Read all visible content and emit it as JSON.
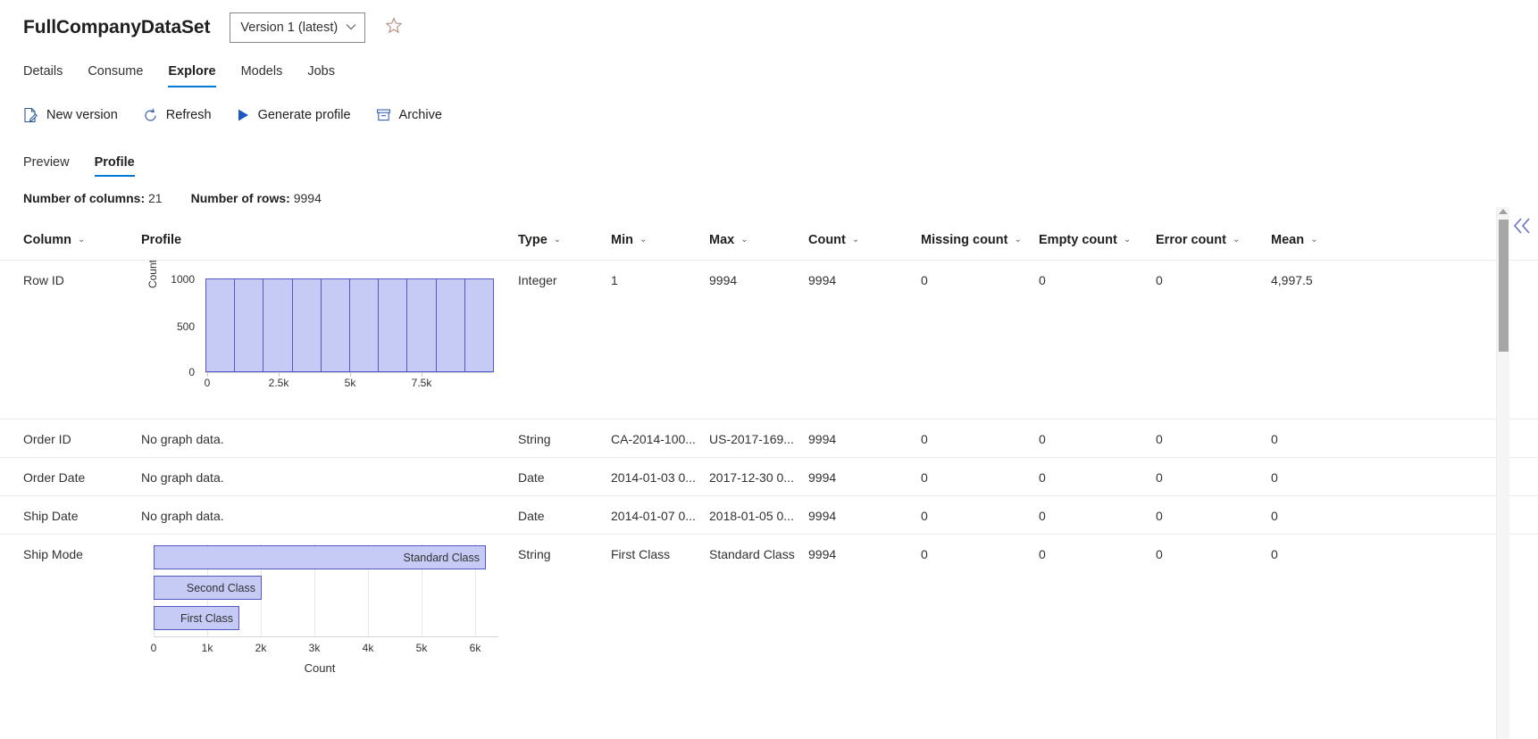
{
  "header": {
    "dataset_title": "FullCompanyDataSet",
    "version_value": "Version 1 (latest)",
    "version_chevron": "chevron-down-icon",
    "favorite_icon": "star-outline-icon"
  },
  "pivot_tabs": [
    {
      "label": "Details",
      "selected": false
    },
    {
      "label": "Consume",
      "selected": false
    },
    {
      "label": "Explore",
      "selected": true
    },
    {
      "label": "Models",
      "selected": false
    },
    {
      "label": "Jobs",
      "selected": false
    }
  ],
  "commands": [
    {
      "label": "New version",
      "icon": "new-document-icon"
    },
    {
      "label": "Refresh",
      "icon": "refresh-icon"
    },
    {
      "label": "Generate profile",
      "icon": "play-triangle-icon"
    },
    {
      "label": "Archive",
      "icon": "archive-box-icon"
    }
  ],
  "sub_tabs": [
    {
      "label": "Preview",
      "selected": false
    },
    {
      "label": "Profile",
      "selected": true
    }
  ],
  "stats": {
    "columns_label": "Number of columns:",
    "columns_value": "21",
    "rows_label": "Number of rows:",
    "rows_value": "9994"
  },
  "table": {
    "headers": [
      {
        "label": "Column",
        "sortable": true
      },
      {
        "label": "Profile",
        "sortable": false
      },
      {
        "label": "Type",
        "sortable": true
      },
      {
        "label": "Min",
        "sortable": true
      },
      {
        "label": "Max",
        "sortable": true
      },
      {
        "label": "Count",
        "sortable": true
      },
      {
        "label": "Missing count",
        "sortable": true
      },
      {
        "label": "Empty count",
        "sortable": true
      },
      {
        "label": "Error count",
        "sortable": true
      },
      {
        "label": "Mean",
        "sortable": true
      }
    ],
    "rows": [
      {
        "column": "Row ID",
        "profile_kind": "histogram",
        "type": "Integer",
        "min": "1",
        "max": "9994",
        "count": "9994",
        "missing_count": "0",
        "empty_count": "0",
        "error_count": "0",
        "mean": "4,997.5"
      },
      {
        "column": "Order ID",
        "profile_kind": "none",
        "profile_text": "No graph data.",
        "type": "String",
        "min": "CA-2014-100...",
        "max": "US-2017-169...",
        "count": "9994",
        "missing_count": "0",
        "empty_count": "0",
        "error_count": "0",
        "mean": "0"
      },
      {
        "column": "Order Date",
        "profile_kind": "none",
        "profile_text": "No graph data.",
        "type": "Date",
        "min": "2014-01-03 0...",
        "max": "2017-12-30 0...",
        "count": "9994",
        "missing_count": "0",
        "empty_count": "0",
        "error_count": "0",
        "mean": "0"
      },
      {
        "column": "Ship Date",
        "profile_kind": "none",
        "profile_text": "No graph data.",
        "type": "Date",
        "min": "2014-01-07 0...",
        "max": "2018-01-05 0...",
        "count": "9994",
        "missing_count": "0",
        "empty_count": "0",
        "error_count": "0",
        "mean": "0"
      },
      {
        "column": "Ship Mode",
        "profile_kind": "barchart",
        "type": "String",
        "min": "First Class",
        "max": "Standard Class",
        "count": "9994",
        "missing_count": "0",
        "empty_count": "0",
        "error_count": "0",
        "mean": "0"
      }
    ]
  },
  "chart_data": [
    {
      "type": "bar",
      "id": "row-id-histogram",
      "title": "",
      "xlabel": "",
      "ylabel": "Count (approx)",
      "categories": [
        "0-1k",
        "1k-2k",
        "2k-3k",
        "3k-4k",
        "4k-5k",
        "5k-6k",
        "6k-7k",
        "7k-8k",
        "8k-9k",
        "9k-9994"
      ],
      "values": [
        1000,
        1000,
        1000,
        1000,
        1000,
        1000,
        1000,
        1000,
        1000,
        1000
      ],
      "xticks": [
        "0",
        "2.5k",
        "5k",
        "7.5k"
      ],
      "xtick_values": [
        0,
        2500,
        5000,
        7500
      ],
      "yticks": [
        "0",
        "500",
        "1000"
      ],
      "ytick_values": [
        0,
        500,
        1000
      ],
      "xlim": [
        0,
        9994
      ],
      "ylim": [
        0,
        1000
      ],
      "grid": false,
      "bar_fill": "#c5cbf5",
      "bar_stroke": "#5257c4"
    },
    {
      "type": "bar",
      "id": "ship-mode-barchart",
      "orientation": "horizontal",
      "title": "",
      "xlabel": "Count",
      "ylabel": "",
      "categories": [
        "Standard Class",
        "Second Class",
        "First Class"
      ],
      "values": [
        5968,
        1945,
        1538
      ],
      "xticks": [
        "0",
        "1k",
        "2k",
        "3k",
        "4k",
        "5k",
        "6k"
      ],
      "xtick_values": [
        0,
        1000,
        2000,
        3000,
        4000,
        5000,
        6000
      ],
      "xlim": [
        0,
        6200
      ],
      "grid": true,
      "bar_fill": "#c5cbf5",
      "bar_stroke": "#5257c4"
    }
  ],
  "scroll": {
    "up_arrow_icon": "caret-up-icon",
    "thumb": "scroll-thumb"
  },
  "collapse": {
    "icon": "double-chevron-left-icon"
  },
  "colors": {
    "accent": "#0078d4",
    "bar_fill": "#c5cbf5",
    "bar_stroke": "#5257c4",
    "text": "#323130"
  }
}
